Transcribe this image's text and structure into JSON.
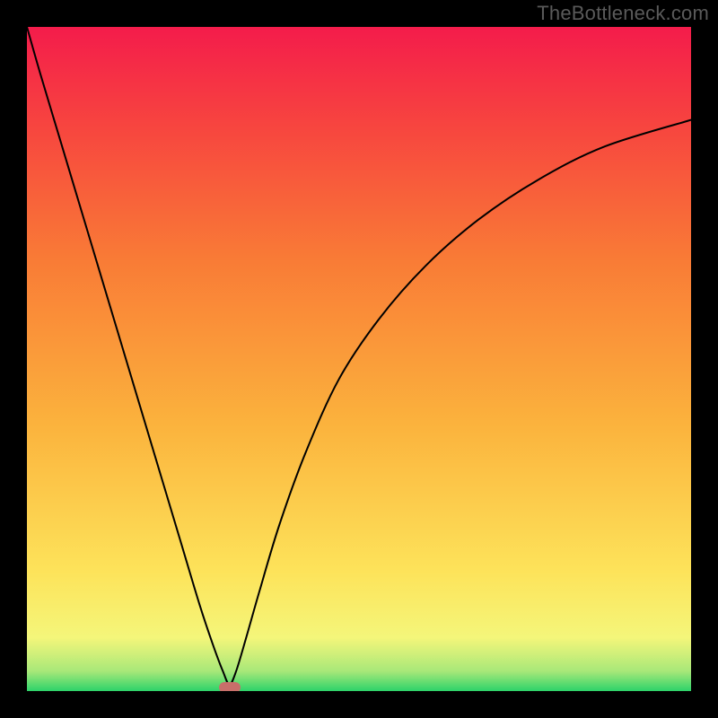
{
  "watermark": "TheBottleneck.com",
  "chart_data": {
    "type": "line",
    "title": "",
    "xlabel": "",
    "ylabel": "",
    "xlim": [
      0,
      100
    ],
    "ylim": [
      0,
      100
    ],
    "background_gradient_stops": [
      {
        "pos": 0.0,
        "color": "#2dd36a"
      },
      {
        "pos": 0.03,
        "color": "#a8e879"
      },
      {
        "pos": 0.08,
        "color": "#f4f67a"
      },
      {
        "pos": 0.18,
        "color": "#fde35a"
      },
      {
        "pos": 0.4,
        "color": "#fbb33d"
      },
      {
        "pos": 0.65,
        "color": "#f97b36"
      },
      {
        "pos": 0.85,
        "color": "#f7453f"
      },
      {
        "pos": 1.0,
        "color": "#f41c4b"
      }
    ],
    "series": [
      {
        "name": "bottleneck-curve",
        "color": "#000000",
        "width": 2,
        "x": [
          0,
          2,
          5,
          8,
          11,
          14,
          17,
          20,
          23,
          26,
          28,
          29.5,
          30.5,
          31.5,
          33,
          35,
          38,
          42,
          47,
          53,
          60,
          68,
          77,
          87,
          100
        ],
        "y": [
          100,
          93,
          83,
          73,
          63,
          53,
          43,
          33,
          23,
          13,
          7,
          3,
          1,
          3,
          8,
          15,
          25,
          36,
          47,
          56,
          64,
          71,
          77,
          82,
          86
        ]
      }
    ],
    "marker": {
      "x": 30.5,
      "y": 0.6,
      "color": "#c96f6a"
    }
  }
}
